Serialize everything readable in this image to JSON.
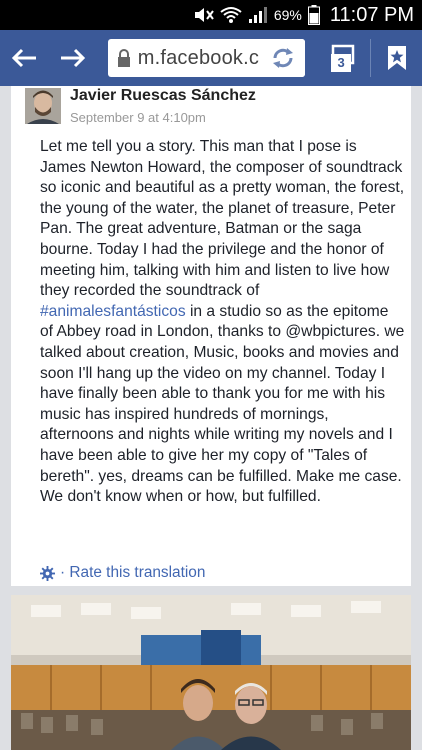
{
  "status_bar": {
    "battery_percent": "69%",
    "clock": "11:07 PM",
    "icons": [
      "mute-icon",
      "wifi-icon",
      "signal-icon",
      "battery-icon"
    ]
  },
  "browser": {
    "url": "m.facebook.c",
    "tab_count": "3",
    "theme_color": "#3b5998",
    "icons": [
      "back-arrow-icon",
      "forward-arrow-icon",
      "lock-icon",
      "refresh-icon",
      "tabs-icon",
      "bookmark-icon"
    ]
  },
  "post": {
    "author": "Javier Ruescas Sánchez",
    "time": "September 9 at 4:10pm",
    "text_before_hashtag": "Let me tell you a story. This man that I pose is James Newton Howard, the composer of soundtrack so iconic and beautiful as a pretty woman, the forest, the young of the water, the planet of treasure, Peter Pan. The great adventure, Batman or the saga bourne. Today I had the privilege and the honor of meeting him, talking with him and listen to live how they recorded the soundtrack of ",
    "hashtag": "#animalesfantásticos",
    "text_after_hashtag": " in a studio so as the epitome of Abbey road in London, thanks to @wbpictures. we talked about creation, Music, books and movies and soon I'll hang up the video on my channel. Today I have finally been able to thank you for me with his music has inspired hundreds of mornings, afternoons and nights while writing my novels and I have been able to give her my copy of \"Tales of bereth\". yes, dreams can be fulfilled. Make me case. We don't know when or how, but fulfilled.",
    "rate_translation": "· Rate this translation",
    "link_color": "#4267b2"
  }
}
